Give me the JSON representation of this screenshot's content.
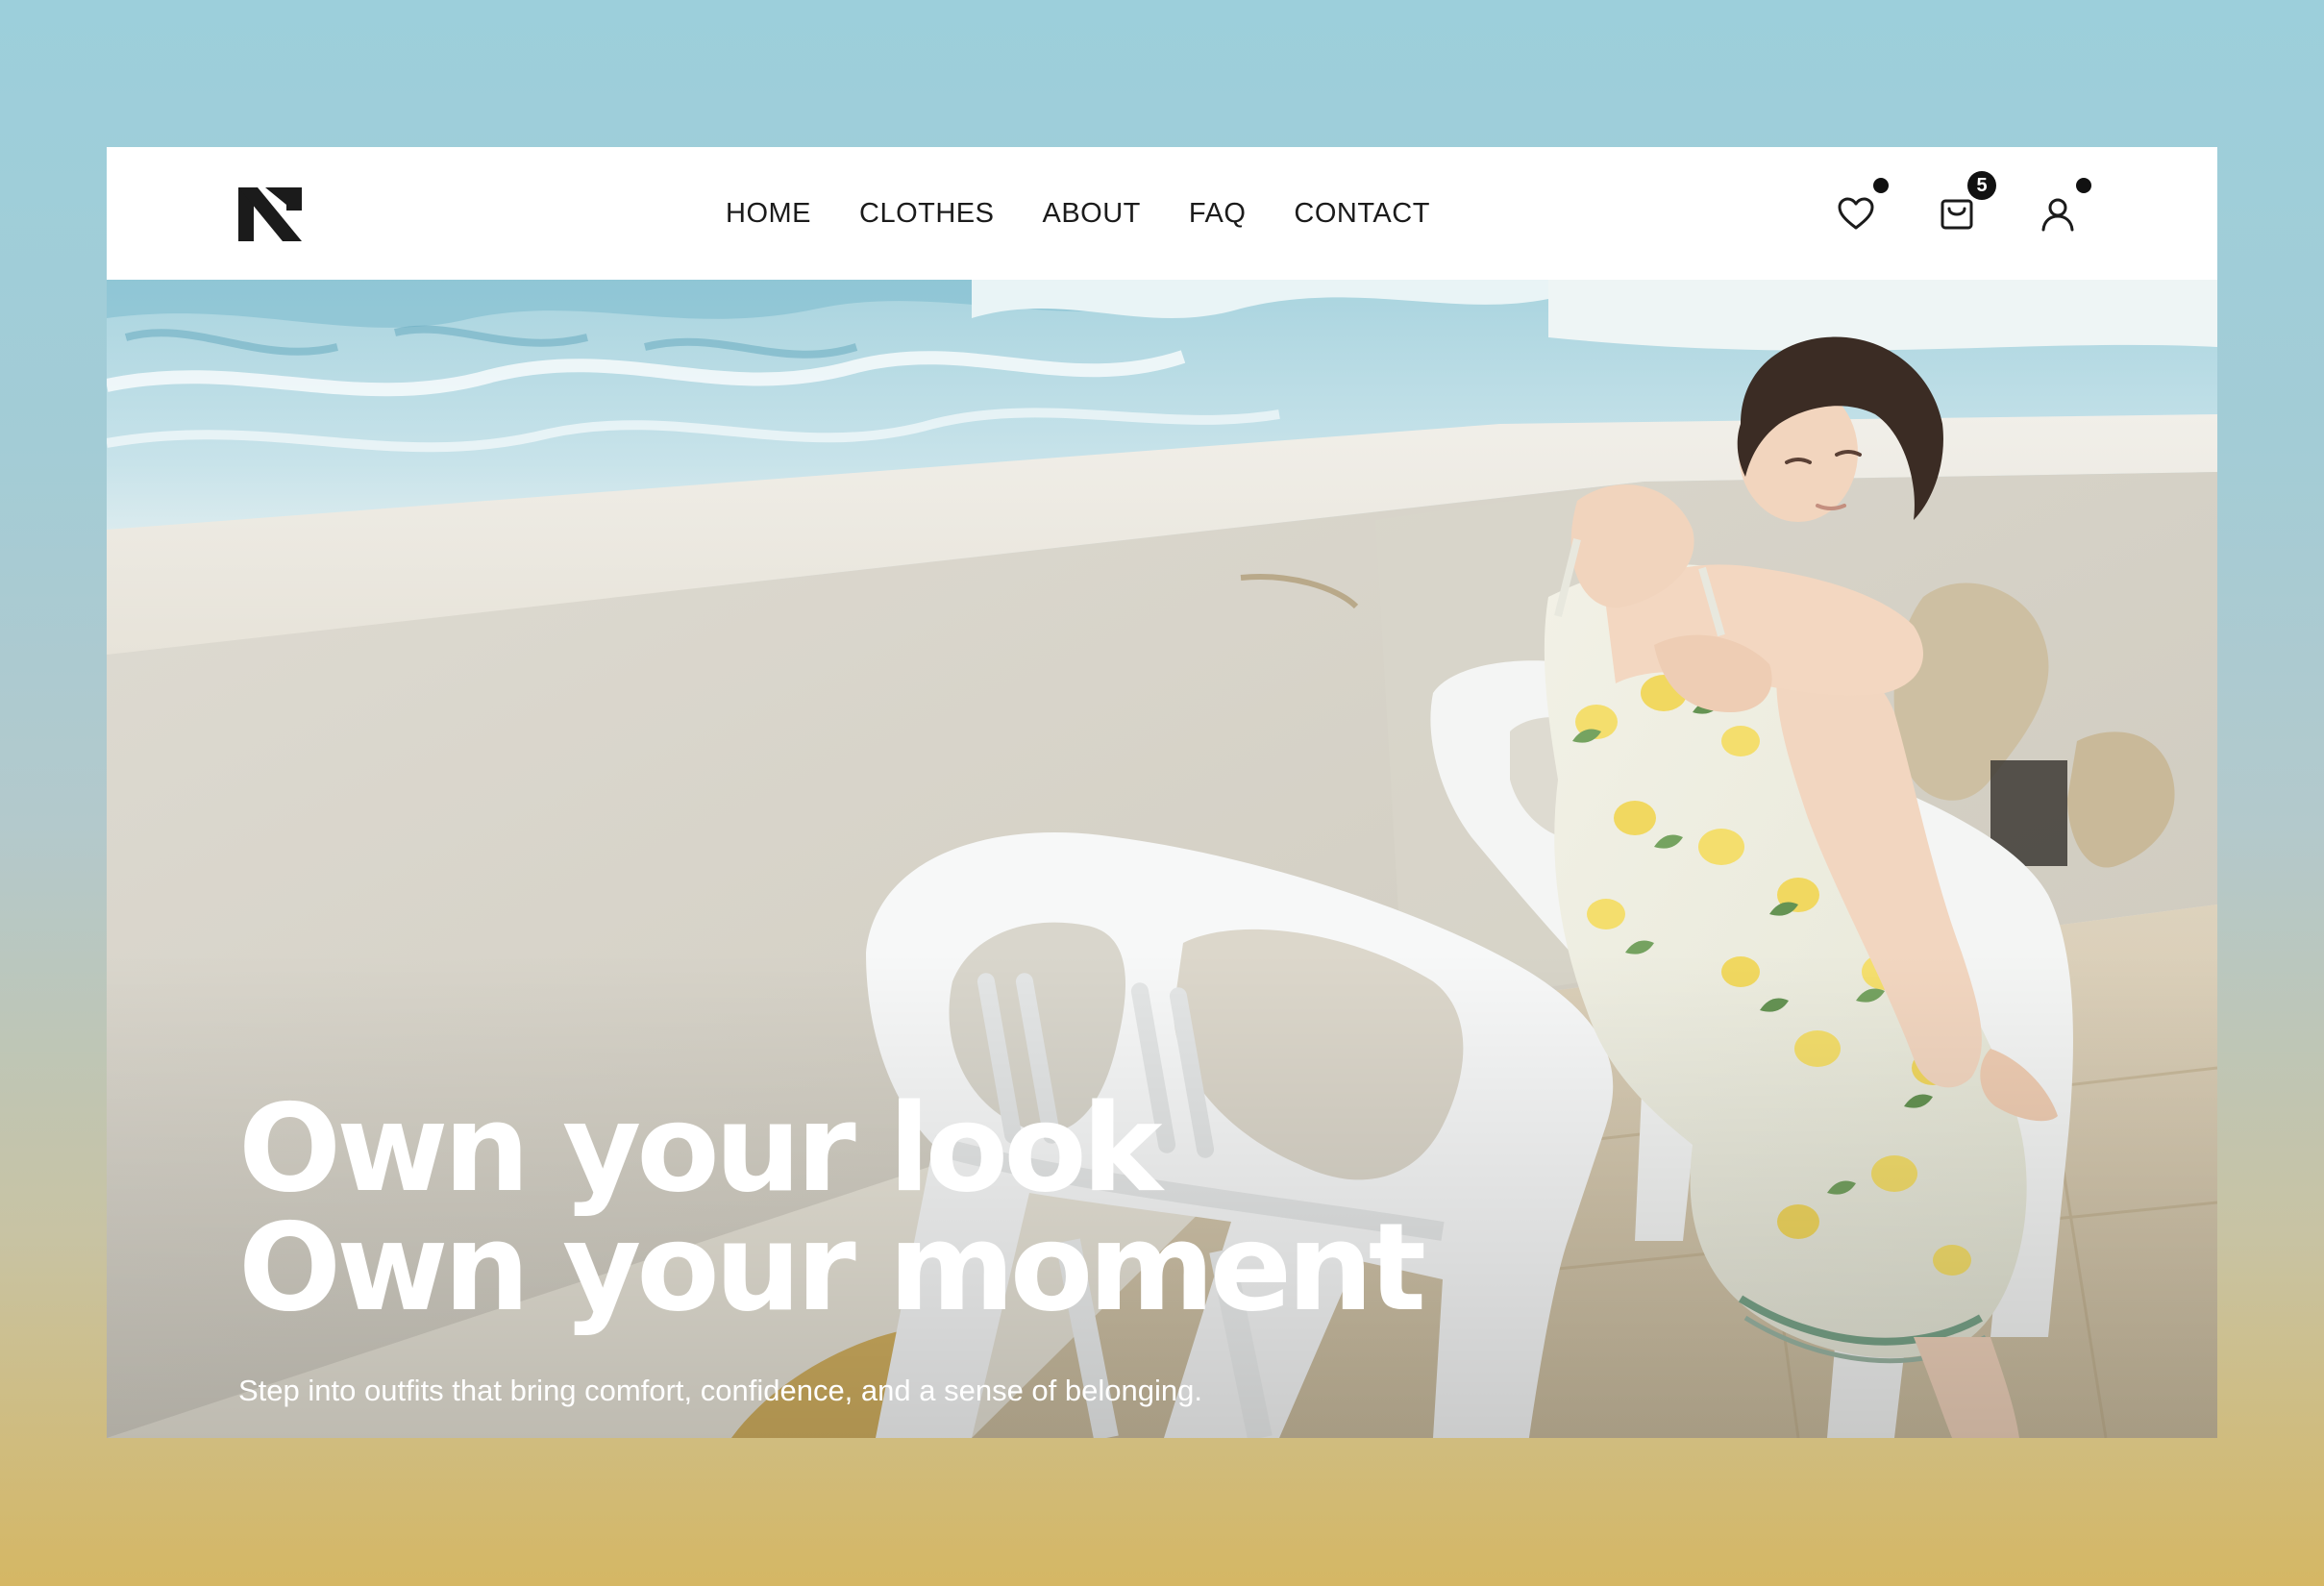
{
  "brand": {
    "logo_icon": "n-logo-icon"
  },
  "nav": {
    "links": [
      {
        "label": "HOME"
      },
      {
        "label": "CLOTHES"
      },
      {
        "label": "ABOUT"
      },
      {
        "label": "FAQ"
      },
      {
        "label": "CONTACT"
      }
    ],
    "icons": {
      "wishlist": "heart-icon",
      "cart": "shopping-bag-icon",
      "account": "user-icon"
    },
    "cart_count": "5"
  },
  "hero": {
    "headline_line1": "Own your look",
    "headline_line2": "Own your moment",
    "subtext": "Step into outfits that bring comfort, confidence, and a sense of belonging."
  },
  "colors": {
    "accent": "#111111",
    "background_top": "#9ccfdb",
    "background_bottom": "#d5b764"
  }
}
